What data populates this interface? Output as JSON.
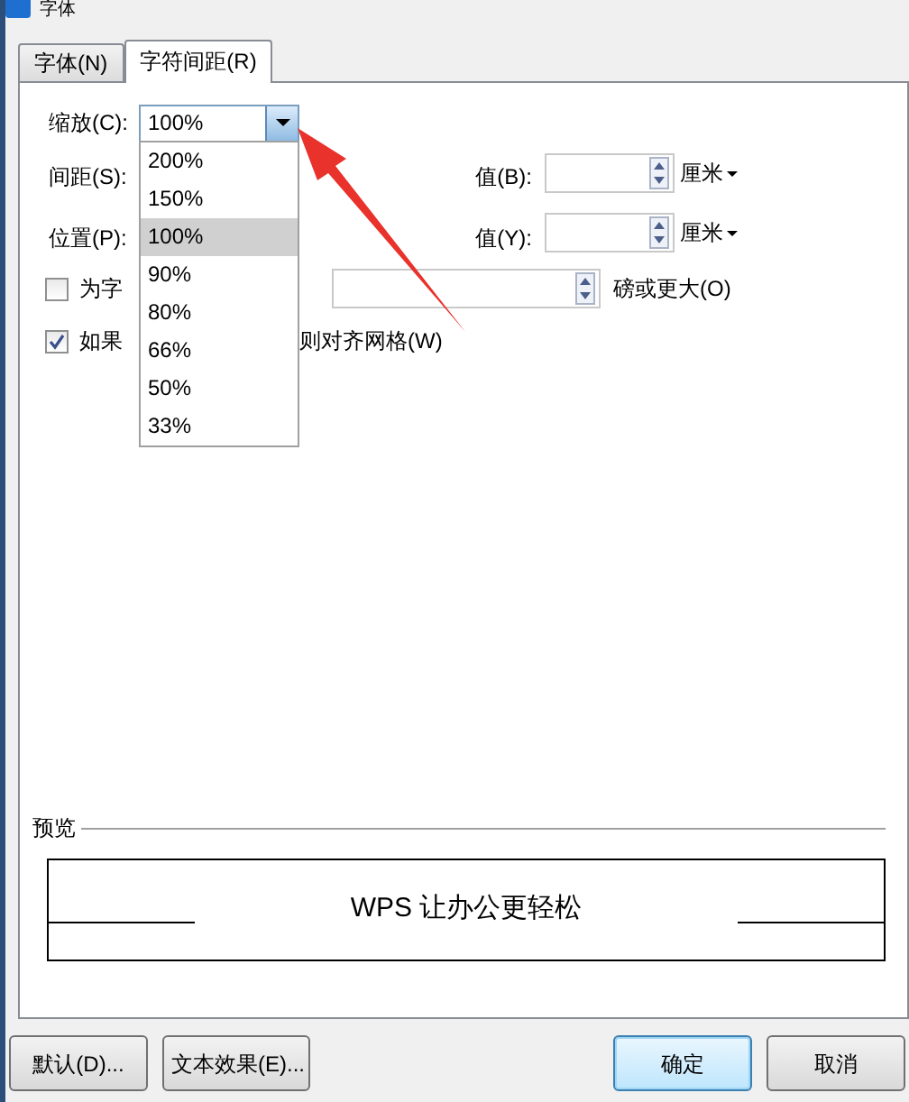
{
  "window": {
    "title": "字体"
  },
  "tabs": [
    {
      "label": "字体(N)",
      "selected": false
    },
    {
      "label": "字符间距(R)",
      "selected": true
    }
  ],
  "scale": {
    "label": "缩放(C):",
    "value": "100%",
    "expanded": true,
    "options": [
      {
        "label": "200%",
        "selected": false
      },
      {
        "label": "150%",
        "selected": false
      },
      {
        "label": "100%",
        "selected": true
      },
      {
        "label": "90%",
        "selected": false
      },
      {
        "label": "80%",
        "selected": false
      },
      {
        "label": "66%",
        "selected": false
      },
      {
        "label": "50%",
        "selected": false
      },
      {
        "label": "33%",
        "selected": false
      }
    ]
  },
  "spacing": {
    "label": "间距(S):",
    "value_label": "值(B):",
    "unit": "厘米"
  },
  "position": {
    "label": "位置(P):",
    "value_label": "值(Y):",
    "unit": "厘米"
  },
  "kerning": {
    "label": "为字",
    "checked": false,
    "suffix": "磅或更大(O)"
  },
  "grid": {
    "label_start": "如果",
    "label_end": "则对齐网格(W)",
    "checked": true
  },
  "preview": {
    "title": "预览",
    "text": "WPS 让办公更轻松"
  },
  "buttons": [
    {
      "label": "默认(D)...",
      "kind": "left",
      "focused": false
    },
    {
      "label": "文本效果(E)...",
      "kind": "left",
      "focused": false
    },
    {
      "label": "确定",
      "kind": "right",
      "focused": true
    },
    {
      "label": "取消",
      "kind": "right",
      "focused": false
    }
  ]
}
